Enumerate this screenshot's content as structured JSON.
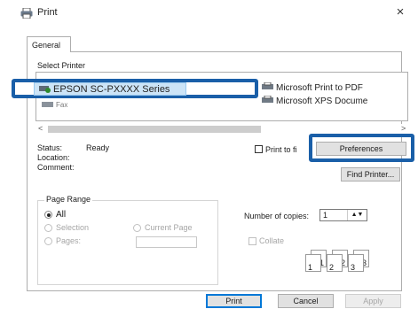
{
  "window": {
    "title": "Print",
    "close": "×"
  },
  "tabs": [
    "General"
  ],
  "select_printer": {
    "label": "Select Printer",
    "printers": [
      {
        "name": "EPSON SC-PXXXX Series",
        "selected": true
      },
      {
        "name": "Microsoft Print to PDF"
      },
      {
        "name": "Microsoft XPS Docume"
      },
      {
        "name": "Fax"
      }
    ],
    "scroll_left": "<",
    "scroll_right": ">"
  },
  "status": {
    "status_label": "Status:",
    "status_value": "Ready",
    "location_label": "Location:",
    "comment_label": "Comment:"
  },
  "print_to_file_label": "Print to fi",
  "preferences_button": "Preferences",
  "find_printer_button": "Find Printer...",
  "page_range": {
    "title": "Page Range",
    "all": "All",
    "selection": "Selection",
    "current_page": "Current Page",
    "pages": "Pages:"
  },
  "copies": {
    "label": "Number of copies:",
    "value": "1",
    "collate_label": "Collate",
    "collate_pages": [
      "1",
      "1",
      "2",
      "2",
      "3",
      "3"
    ]
  },
  "footer": {
    "print": "Print",
    "cancel": "Cancel",
    "apply": "Apply"
  },
  "colors": {
    "highlight": "#1a5fa8",
    "selection": "#cce4f7"
  }
}
